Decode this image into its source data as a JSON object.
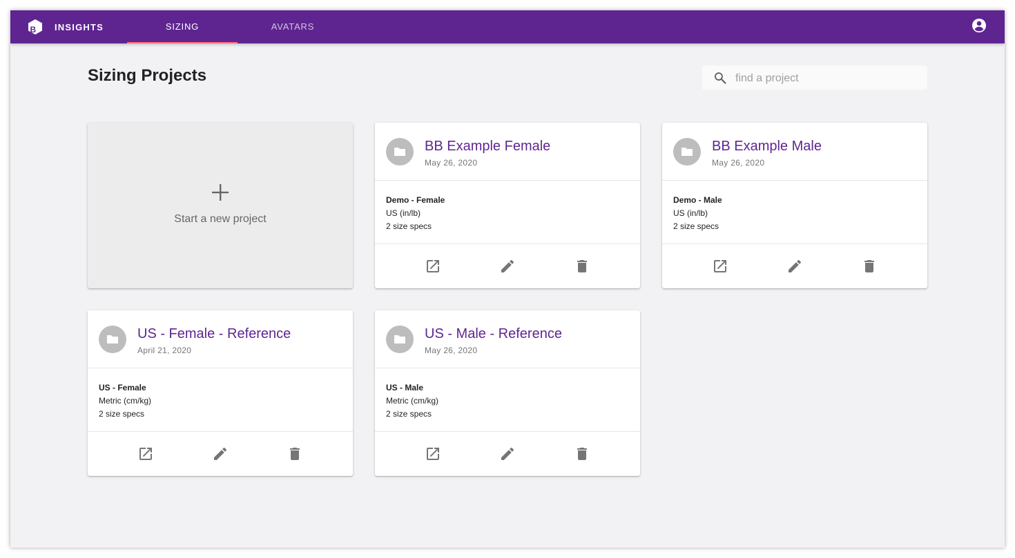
{
  "app": {
    "brand": "INSIGHTS"
  },
  "nav": {
    "tabs": [
      {
        "label": "SIZING",
        "active": true
      },
      {
        "label": "AVATARS",
        "active": false
      }
    ]
  },
  "page": {
    "title": "Sizing Projects"
  },
  "search": {
    "placeholder": "find a project",
    "value": ""
  },
  "new_project": {
    "label": "Start a new project"
  },
  "projects": [
    {
      "title": "BB Example Female",
      "date": "May 26, 2020",
      "spec_name": "Demo - Female",
      "units": "US (in/lb)",
      "spec_count": "2 size specs"
    },
    {
      "title": "BB Example Male",
      "date": "May 26, 2020",
      "spec_name": "Demo - Male",
      "units": "US (in/lb)",
      "spec_count": "2 size specs"
    },
    {
      "title": "US - Female - Reference",
      "date": "April 21, 2020",
      "spec_name": "US - Female",
      "units": "Metric (cm/kg)",
      "spec_count": "2 size specs"
    },
    {
      "title": "US - Male - Reference",
      "date": "May 26, 2020",
      "spec_name": "US - Male",
      "units": "Metric (cm/kg)",
      "spec_count": "2 size specs"
    }
  ],
  "colors": {
    "appbar": "#5e2591",
    "tab_indicator": "#ff6e7c",
    "title_accent": "#5e2591",
    "background": "#f2f2f4",
    "icon_gray": "#757575"
  },
  "icons": {
    "logo": "hexagon-b-logo-icon",
    "account": "account-circle-icon",
    "search": "search-icon",
    "new": "plus-icon",
    "folder": "folder-icon",
    "open": "open-in-new-icon",
    "edit": "pencil-icon",
    "delete": "trash-icon"
  }
}
